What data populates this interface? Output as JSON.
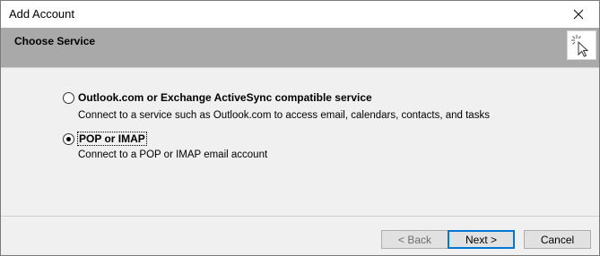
{
  "window": {
    "title": "Add Account",
    "close_icon": "close-icon"
  },
  "header": {
    "title": "Choose Service",
    "icon": "cursor-click-icon"
  },
  "options": [
    {
      "label": "Outlook.com or Exchange ActiveSync compatible service",
      "description": "Connect to a service such as Outlook.com to access email, calendars, contacts, and tasks",
      "selected": false
    },
    {
      "label": "POP or IMAP",
      "description": "Connect to a POP or IMAP email account",
      "selected": true
    }
  ],
  "buttons": {
    "back": "< Back",
    "next": "Next >",
    "cancel": "Cancel"
  }
}
